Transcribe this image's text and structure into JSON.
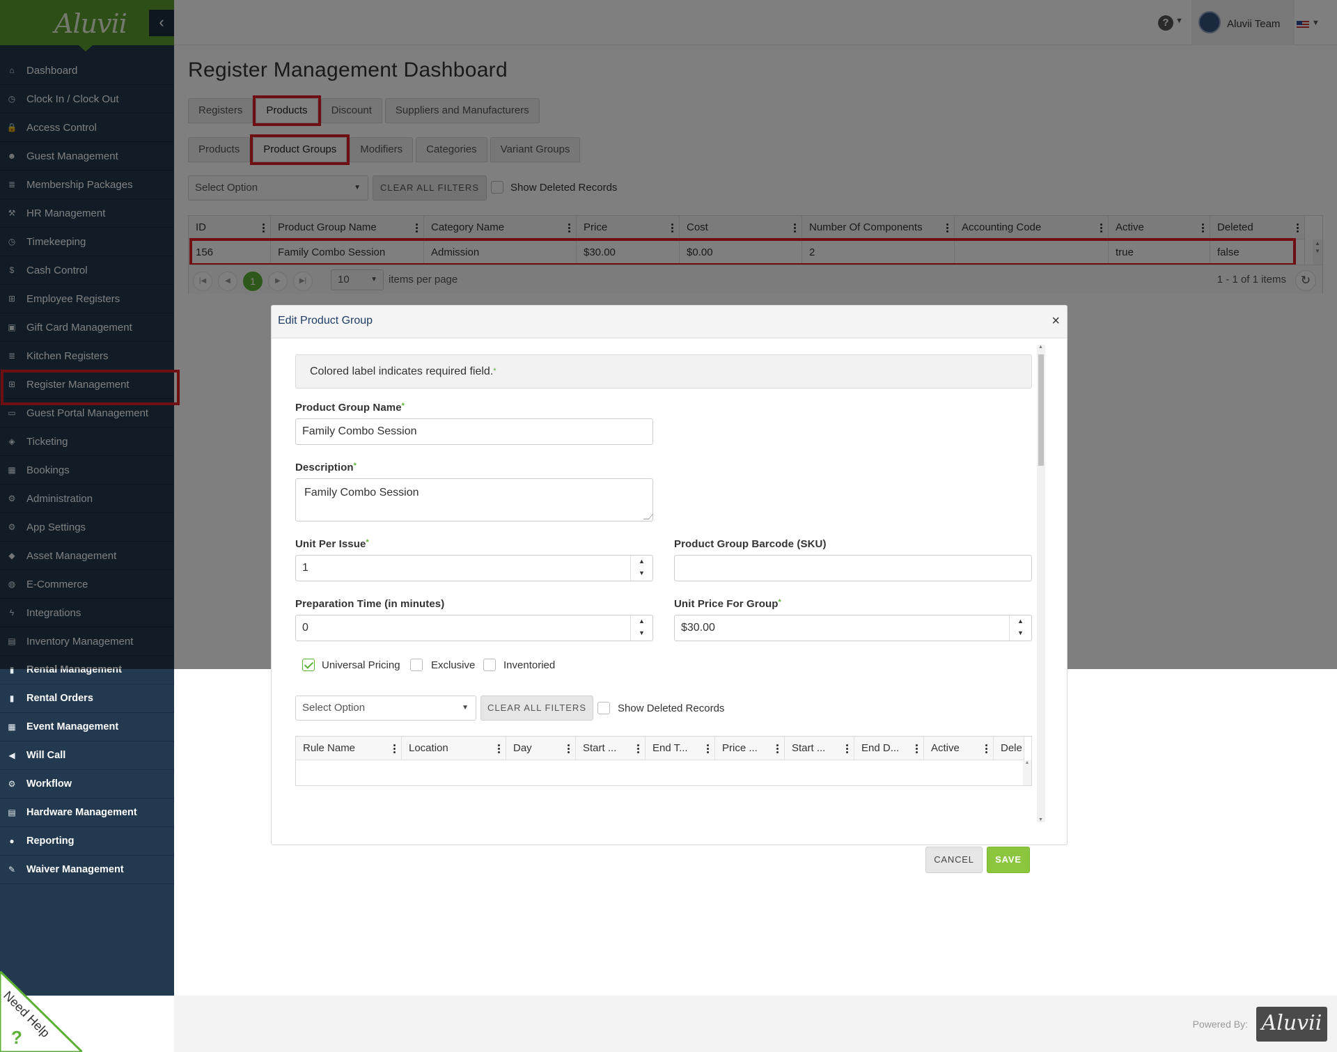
{
  "brand": {
    "name": "Aluvii"
  },
  "sidebar": {
    "items": [
      {
        "label": "Dashboard",
        "icon": "home-icon"
      },
      {
        "label": "Clock In / Clock Out",
        "icon": "clock-icon"
      },
      {
        "label": "Access Control",
        "icon": "lock-icon"
      },
      {
        "label": "Guest Management",
        "icon": "users-icon"
      },
      {
        "label": "Membership Packages",
        "icon": "list-icon"
      },
      {
        "label": "HR Management",
        "icon": "tools-icon"
      },
      {
        "label": "Timekeeping",
        "icon": "clock-icon"
      },
      {
        "label": "Cash Control",
        "icon": "dollar-icon"
      },
      {
        "label": "Employee Registers",
        "icon": "cart-icon"
      },
      {
        "label": "Gift Card Management",
        "icon": "gift-icon"
      },
      {
        "label": "Kitchen Registers",
        "icon": "list-icon"
      },
      {
        "label": "Register Management",
        "icon": "cart-icon"
      },
      {
        "label": "Guest Portal Management",
        "icon": "laptop-icon"
      },
      {
        "label": "Ticketing",
        "icon": "ticket-icon"
      },
      {
        "label": "Bookings",
        "icon": "calendar-icon"
      },
      {
        "label": "Administration",
        "icon": "cogs-icon"
      },
      {
        "label": "App Settings",
        "icon": "gear-icon"
      },
      {
        "label": "Asset Management",
        "icon": "cubes-icon"
      },
      {
        "label": "E-Commerce",
        "icon": "globe-icon"
      },
      {
        "label": "Integrations",
        "icon": "bolt-icon"
      },
      {
        "label": "Inventory Management",
        "icon": "archive-icon"
      },
      {
        "label": "Rental Management",
        "icon": "clipboard-icon"
      },
      {
        "label": "Rental Orders",
        "icon": "book-icon"
      },
      {
        "label": "Event Management",
        "icon": "calendar-check-icon"
      },
      {
        "label": "Will Call",
        "icon": "megaphone-icon"
      },
      {
        "label": "Workflow",
        "icon": "gear-icon"
      },
      {
        "label": "Hardware Management",
        "icon": "print-icon"
      },
      {
        "label": "Reporting",
        "icon": "lightbulb-icon"
      },
      {
        "label": "Waiver Management",
        "icon": "pen-icon"
      }
    ],
    "need_help": "Need Help"
  },
  "topbar": {
    "user_name": "Aluvii Team",
    "help_icon": "question-icon"
  },
  "page": {
    "title": "Register Management Dashboard"
  },
  "tabs_main": [
    "Registers",
    "Products",
    "Discount",
    "Suppliers and Manufacturers"
  ],
  "tabs_sub": [
    "Products",
    "Product Groups",
    "Modifiers",
    "Categories",
    "Variant Groups"
  ],
  "filters": {
    "select_placeholder": "Select Option",
    "clear_label": "CLEAR ALL FILTERS",
    "show_deleted_label": "Show Deleted Records"
  },
  "grid": {
    "columns": [
      "ID",
      "Product Group Name",
      "Category Name",
      "Price",
      "Cost",
      "Number Of Components",
      "Accounting Code",
      "Active",
      "Deleted"
    ],
    "rows": [
      [
        "156",
        "Family Combo Session",
        "Admission",
        "$30.00",
        "$0.00",
        "2",
        "",
        "true",
        "false"
      ]
    ],
    "pager": {
      "current_page": "1",
      "page_size": "10",
      "items_per_page_label": "items per page",
      "info": "1 - 1 of 1 items"
    }
  },
  "modal": {
    "title": "Edit Product Group",
    "required_note": "Colored label indicates required field.",
    "fields": {
      "product_group_name_label": "Product Group Name",
      "product_group_name_value": "Family Combo Session",
      "description_label": "Description",
      "description_value": "Family Combo Session",
      "unit_per_issue_label": "Unit Per Issue",
      "unit_per_issue_value": "1",
      "barcode_label": "Product Group Barcode (SKU)",
      "barcode_value": "",
      "prep_time_label": "Preparation Time (in minutes)",
      "prep_time_value": "0",
      "unit_price_label": "Unit Price For Group",
      "unit_price_value": "$30.00"
    },
    "checkboxes": [
      {
        "label": "Universal Pricing",
        "checked": true
      },
      {
        "label": "Exclusive",
        "checked": false
      },
      {
        "label": "Inventoried",
        "checked": false
      }
    ],
    "rules_filters": {
      "select_placeholder": "Select Option",
      "clear_label": "CLEAR ALL FILTERS",
      "show_deleted_label": "Show Deleted Records"
    },
    "rules_columns": [
      "Rule Name",
      "Location",
      "Day",
      "Start ...",
      "End T...",
      "Price ...",
      "Start ...",
      "End D...",
      "Active",
      "Dele"
    ],
    "cancel_label": "CANCEL",
    "save_label": "SAVE"
  },
  "footer": {
    "powered_by": "Powered By:",
    "logo_text": "Aluvii"
  },
  "colors": {
    "sidebar_bg": "#22394f",
    "brand_green": "#5d9d2f",
    "accent_green": "#8cc63f",
    "highlight_red": "#e01e26"
  }
}
